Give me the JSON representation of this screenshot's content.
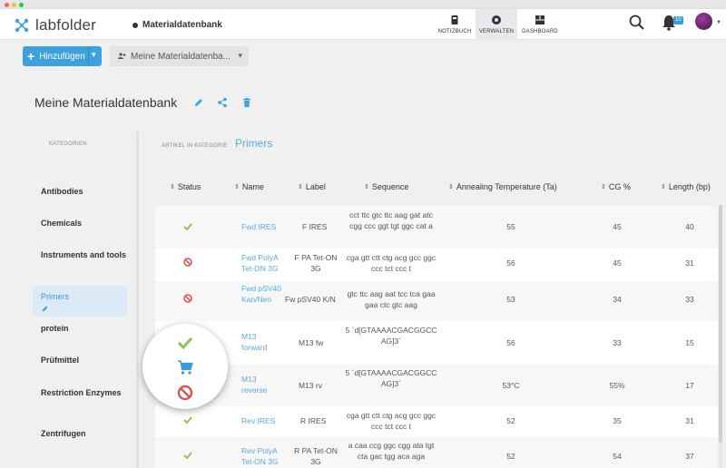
{
  "app": {
    "logo_text": "labfolder"
  },
  "breadcrumb": {
    "label": "Materialdatenbank"
  },
  "nav_tabs": [
    {
      "label": "NOTIZBUCH",
      "icon": "notebook-icon",
      "active": false
    },
    {
      "label": "VERWALTEN",
      "icon": "manage-icon",
      "active": true
    },
    {
      "label": "DASHBOARD",
      "icon": "dashboard-icon",
      "active": false
    }
  ],
  "notifications": {
    "count": "10"
  },
  "toolbar": {
    "add_label": "Hinzufügen",
    "db_select": "Meine Materialdatenba..."
  },
  "database": {
    "title": "Meine Materialdatenbank"
  },
  "categories": {
    "heading": "KATEGORIEN",
    "items": [
      {
        "label": "Antibodies",
        "active": false
      },
      {
        "label": "Chemicals",
        "active": false
      },
      {
        "label": "Instruments and tools",
        "active": false
      },
      {
        "label": "Primers",
        "active": true
      },
      {
        "label": "protein",
        "active": false
      },
      {
        "label": "Prüfmittel",
        "active": false
      },
      {
        "label": "Restriction Enzymes",
        "active": false
      },
      {
        "label": "Zentrifugen",
        "active": false
      }
    ]
  },
  "items_panel": {
    "heading": "ARTIKEL IN KATEGORIE",
    "category": "Primers"
  },
  "table": {
    "columns": [
      "Status",
      "Name",
      "Label",
      "Sequence",
      "Annealing Temperature (Ta)",
      "CG %",
      "Length (bp)"
    ],
    "rows": [
      {
        "status": "available",
        "name": "Fwd IRES",
        "label": "F IRES",
        "sequence": "cct ttc gtc ttc aag gat atc cgg ccc ggt tgt ggc cat a",
        "ta": "55",
        "cg": "45",
        "length": "40"
      },
      {
        "status": "blocked",
        "name": "Fwd PolyA Tet-ON 3G",
        "label": "F PA Tet-ON 3G",
        "sequence": "cga gtt ctt ctg acg gcc ggc ccc tct ccc t",
        "ta": "56",
        "cg": "45",
        "length": "31"
      },
      {
        "status": "blocked",
        "name": "Fwd pSV40 Kan/Neo",
        "label": "Fw pSV40 K/N",
        "sequence": "gtc ttc aag aat tcc tca gaa gaa ctc gtc aag",
        "ta": "53",
        "cg": "34",
        "length": "33"
      },
      {
        "status": "available",
        "name": "M13 forward",
        "label": "M13 fw",
        "sequence": "5 ´d[GTAAAACGACGGCCAG]3´",
        "ta": "56",
        "cg": "33",
        "length": "15"
      },
      {
        "status": "order",
        "name": "M13 reverse",
        "label": "M13 rv",
        "sequence": "5 ´d[GTAAAACGACGGCCAG]3´",
        "ta": "53°C",
        "cg": "55%",
        "length": "17"
      },
      {
        "status": "available",
        "name": "Rev IRES",
        "label": "R IRES",
        "sequence": "cga gtt ctt ctg acg gcc ggc ccc tct ccc t",
        "ta": "52",
        "cg": "35",
        "length": "31"
      },
      {
        "status": "available",
        "name": "Rev PolyA Tet-ON 3G",
        "label": "R PA Tet-ON 3G",
        "sequence": "a caa ccg ggc cgg ata tgt cta gac tgg aca aga",
        "ta": "52",
        "cg": "54",
        "length": "37"
      }
    ]
  },
  "colors": {
    "accent": "#3da1de",
    "link": "#58aae2",
    "ok": "#8bc34a",
    "blocked": "#d9534f",
    "order": "#3a9ad9"
  }
}
